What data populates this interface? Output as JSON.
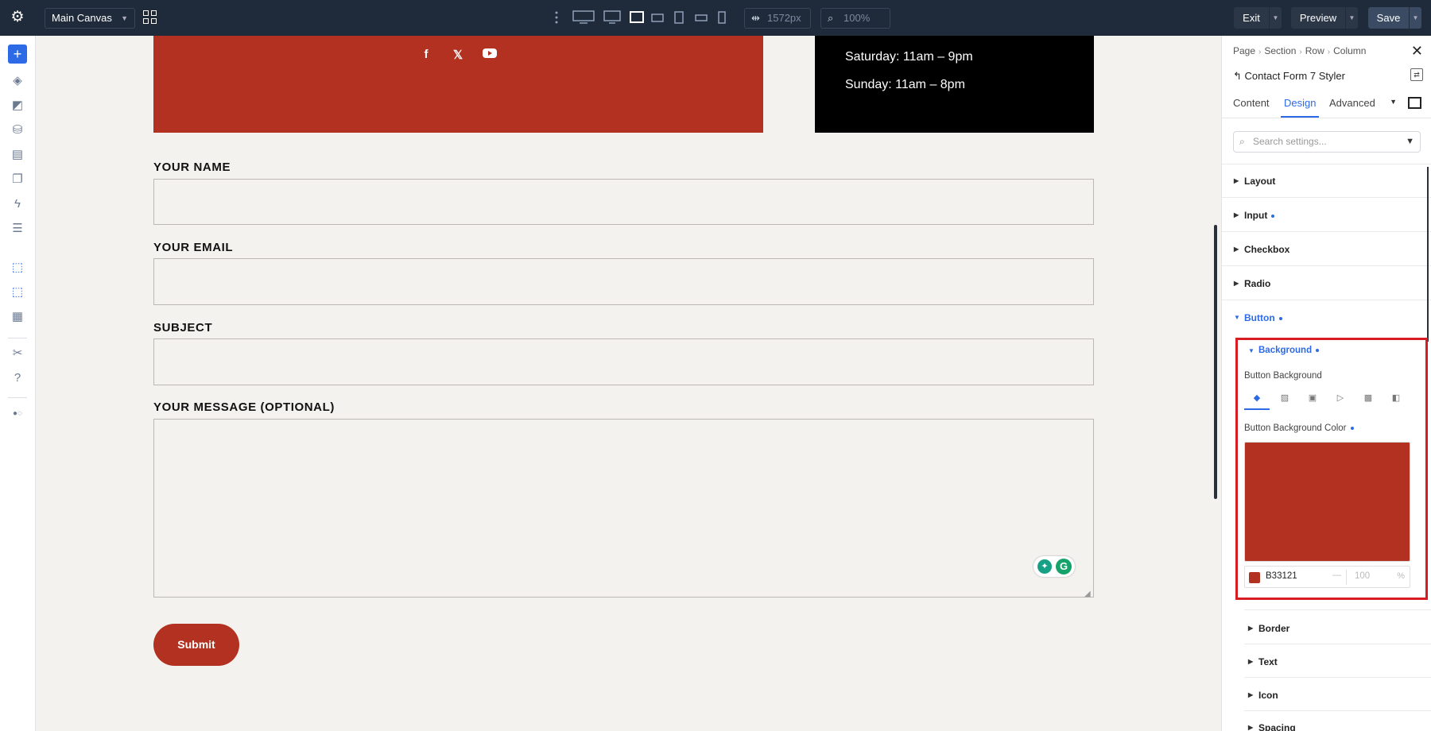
{
  "topbar": {
    "canvas_select": "Main Canvas",
    "width_value": "1572px",
    "zoom_value": "100%",
    "exit_label": "Exit",
    "preview_label": "Preview",
    "save_label": "Save"
  },
  "page": {
    "social": [
      "facebook-icon",
      "x-icon",
      "youtube-icon"
    ],
    "hours": [
      "Saturday: 11am – 9pm",
      "Sunday: 11am – 8pm"
    ],
    "form": {
      "labels": [
        "YOUR NAME",
        "YOUR EMAIL",
        "SUBJECT",
        "YOUR MESSAGE (OPTIONAL)"
      ],
      "submit_label": "Submit"
    },
    "colors": {
      "brand_red": "#B33121",
      "topbar": "#1F2A3A",
      "accent": "#2D6AE6"
    }
  },
  "panel": {
    "breadcrumb": [
      "Page",
      "Section",
      "Row",
      "Column"
    ],
    "module_title": "Contact Form 7 Styler",
    "tabs": [
      "Content",
      "Design",
      "Advanced"
    ],
    "active_tab": "Design",
    "search_placeholder": "Search settings...",
    "sections": [
      "Layout",
      "Input",
      "Checkbox",
      "Radio",
      "Button"
    ],
    "background_group": "Background",
    "button_background_label": "Button Background",
    "button_background_color_label": "Button Background Color",
    "color_hex": "B33121",
    "opacity_value": "100",
    "opacity_unit": "%",
    "dash": "—",
    "subsections": [
      "Border",
      "Text",
      "Icon",
      "Spacing"
    ]
  }
}
